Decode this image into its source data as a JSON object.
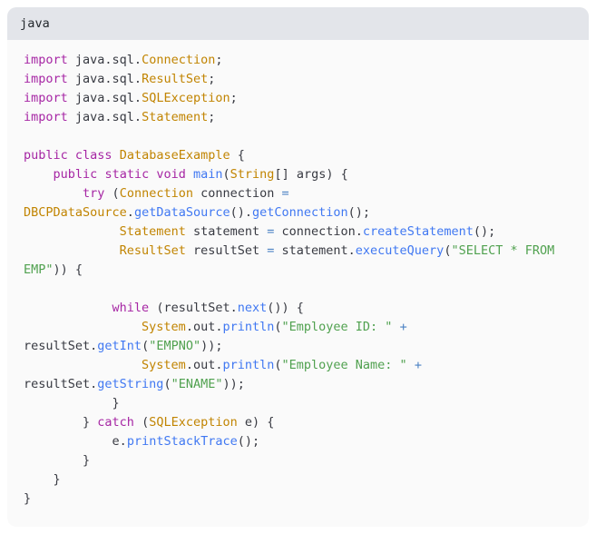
{
  "card": {
    "language_label": "java",
    "background": "#fafafa",
    "header_background": "#e3e5ea"
  },
  "theme": {
    "keyword": "#a626a4",
    "class_name": "#c18401",
    "function": "#4078f2",
    "string": "#50a14f",
    "operator": "#4b81c4",
    "plain": "#383a42"
  },
  "code": {
    "language": "java",
    "full_text": "import java.sql.Connection;\nimport java.sql.ResultSet;\nimport java.sql.SQLException;\nimport java.sql.Statement;\n\npublic class DatabaseExample {\n    public static void main(String[] args) {\n        try (Connection connection = DBCPDataSource.getDataSource().getConnection();\n             Statement statement = connection.createStatement();\n             ResultSet resultSet = statement.executeQuery(\"SELECT * FROM EMP\")) {\n\n            while (resultSet.next()) {\n                System.out.println(\"Employee ID: \" + resultSet.getInt(\"EMPNO\"));\n                System.out.println(\"Employee Name: \" + resultSet.getString(\"ENAME\"));\n            }\n        } catch (SQLException e) {\n            e.printStackTrace();\n        }\n    }\n}",
    "lines": [
      {
        "index": 1,
        "tokens": [
          {
            "t": "import",
            "k": "keyword"
          },
          {
            "t": " java.sql.",
            "k": "plain"
          },
          {
            "t": "Connection",
            "k": "class"
          },
          {
            "t": ";",
            "k": "punct"
          }
        ]
      },
      {
        "index": 2,
        "tokens": [
          {
            "t": "import",
            "k": "keyword"
          },
          {
            "t": " java.sql.",
            "k": "plain"
          },
          {
            "t": "ResultSet",
            "k": "class"
          },
          {
            "t": ";",
            "k": "punct"
          }
        ]
      },
      {
        "index": 3,
        "tokens": [
          {
            "t": "import",
            "k": "keyword"
          },
          {
            "t": " java.sql.",
            "k": "plain"
          },
          {
            "t": "SQLException",
            "k": "class"
          },
          {
            "t": ";",
            "k": "punct"
          }
        ]
      },
      {
        "index": 4,
        "tokens": [
          {
            "t": "import",
            "k": "keyword"
          },
          {
            "t": " java.sql.",
            "k": "plain"
          },
          {
            "t": "Statement",
            "k": "class"
          },
          {
            "t": ";",
            "k": "punct"
          }
        ]
      },
      {
        "index": 5,
        "tokens": []
      },
      {
        "index": 6,
        "tokens": [
          {
            "t": "public",
            "k": "keyword"
          },
          {
            "t": " ",
            "k": "plain"
          },
          {
            "t": "class",
            "k": "keyword"
          },
          {
            "t": " ",
            "k": "plain"
          },
          {
            "t": "DatabaseExample",
            "k": "class"
          },
          {
            "t": " {",
            "k": "punct"
          }
        ]
      },
      {
        "index": 7,
        "tokens": [
          {
            "t": "    ",
            "k": "plain"
          },
          {
            "t": "public",
            "k": "keyword"
          },
          {
            "t": " ",
            "k": "plain"
          },
          {
            "t": "static",
            "k": "keyword"
          },
          {
            "t": " ",
            "k": "plain"
          },
          {
            "t": "void",
            "k": "keyword"
          },
          {
            "t": " ",
            "k": "plain"
          },
          {
            "t": "main",
            "k": "function"
          },
          {
            "t": "(",
            "k": "punct"
          },
          {
            "t": "String",
            "k": "class"
          },
          {
            "t": "[] args) {",
            "k": "punct"
          }
        ]
      },
      {
        "index": 8,
        "tokens": [
          {
            "t": "        ",
            "k": "plain"
          },
          {
            "t": "try",
            "k": "keyword"
          },
          {
            "t": " (",
            "k": "punct"
          },
          {
            "t": "Connection",
            "k": "class"
          },
          {
            "t": " connection ",
            "k": "plain"
          },
          {
            "t": "=",
            "k": "operator"
          },
          {
            "t": " ",
            "k": "plain"
          },
          {
            "t": "DBCPDataSource",
            "k": "class"
          },
          {
            "t": ".",
            "k": "punct"
          },
          {
            "t": "getDataSource",
            "k": "function"
          },
          {
            "t": "().",
            "k": "punct"
          },
          {
            "t": "getConnection",
            "k": "function"
          },
          {
            "t": "();",
            "k": "punct"
          }
        ]
      },
      {
        "index": 9,
        "tokens": [
          {
            "t": "             ",
            "k": "plain"
          },
          {
            "t": "Statement",
            "k": "class"
          },
          {
            "t": " statement ",
            "k": "plain"
          },
          {
            "t": "=",
            "k": "operator"
          },
          {
            "t": " connection.",
            "k": "plain"
          },
          {
            "t": "createStatement",
            "k": "function"
          },
          {
            "t": "();",
            "k": "punct"
          }
        ]
      },
      {
        "index": 10,
        "tokens": [
          {
            "t": "             ",
            "k": "plain"
          },
          {
            "t": "ResultSet",
            "k": "class"
          },
          {
            "t": " resultSet ",
            "k": "plain"
          },
          {
            "t": "=",
            "k": "operator"
          },
          {
            "t": " statement.",
            "k": "plain"
          },
          {
            "t": "executeQuery",
            "k": "function"
          },
          {
            "t": "(",
            "k": "punct"
          },
          {
            "t": "\"SELECT * FROM EMP\"",
            "k": "string"
          },
          {
            "t": ")) {",
            "k": "punct"
          }
        ]
      },
      {
        "index": 11,
        "tokens": []
      },
      {
        "index": 12,
        "tokens": [
          {
            "t": "            ",
            "k": "plain"
          },
          {
            "t": "while",
            "k": "keyword"
          },
          {
            "t": " (resultSet.",
            "k": "plain"
          },
          {
            "t": "next",
            "k": "function"
          },
          {
            "t": "()) {",
            "k": "punct"
          }
        ]
      },
      {
        "index": 13,
        "tokens": [
          {
            "t": "                ",
            "k": "plain"
          },
          {
            "t": "System",
            "k": "class"
          },
          {
            "t": ".out.",
            "k": "plain"
          },
          {
            "t": "println",
            "k": "function"
          },
          {
            "t": "(",
            "k": "punct"
          },
          {
            "t": "\"Employee ID: \"",
            "k": "string"
          },
          {
            "t": " ",
            "k": "plain"
          },
          {
            "t": "+",
            "k": "operator"
          },
          {
            "t": " resultSet.",
            "k": "plain"
          },
          {
            "t": "getInt",
            "k": "function"
          },
          {
            "t": "(",
            "k": "punct"
          },
          {
            "t": "\"EMPNO\"",
            "k": "string"
          },
          {
            "t": "));",
            "k": "punct"
          }
        ]
      },
      {
        "index": 14,
        "tokens": [
          {
            "t": "                ",
            "k": "plain"
          },
          {
            "t": "System",
            "k": "class"
          },
          {
            "t": ".out.",
            "k": "plain"
          },
          {
            "t": "println",
            "k": "function"
          },
          {
            "t": "(",
            "k": "punct"
          },
          {
            "t": "\"Employee Name: \"",
            "k": "string"
          },
          {
            "t": " ",
            "k": "plain"
          },
          {
            "t": "+",
            "k": "operator"
          },
          {
            "t": " resultSet.",
            "k": "plain"
          },
          {
            "t": "getString",
            "k": "function"
          },
          {
            "t": "(",
            "k": "punct"
          },
          {
            "t": "\"ENAME\"",
            "k": "string"
          },
          {
            "t": "));",
            "k": "punct"
          }
        ]
      },
      {
        "index": 15,
        "tokens": [
          {
            "t": "            }",
            "k": "punct"
          }
        ]
      },
      {
        "index": 16,
        "tokens": [
          {
            "t": "        } ",
            "k": "punct"
          },
          {
            "t": "catch",
            "k": "keyword"
          },
          {
            "t": " (",
            "k": "punct"
          },
          {
            "t": "SQLException",
            "k": "class"
          },
          {
            "t": " e) {",
            "k": "punct"
          }
        ]
      },
      {
        "index": 17,
        "tokens": [
          {
            "t": "            e.",
            "k": "plain"
          },
          {
            "t": "printStackTrace",
            "k": "function"
          },
          {
            "t": "();",
            "k": "punct"
          }
        ]
      },
      {
        "index": 18,
        "tokens": [
          {
            "t": "        }",
            "k": "punct"
          }
        ]
      },
      {
        "index": 19,
        "tokens": [
          {
            "t": "    }",
            "k": "punct"
          }
        ]
      },
      {
        "index": 20,
        "tokens": [
          {
            "t": "}",
            "k": "punct"
          }
        ]
      }
    ]
  }
}
